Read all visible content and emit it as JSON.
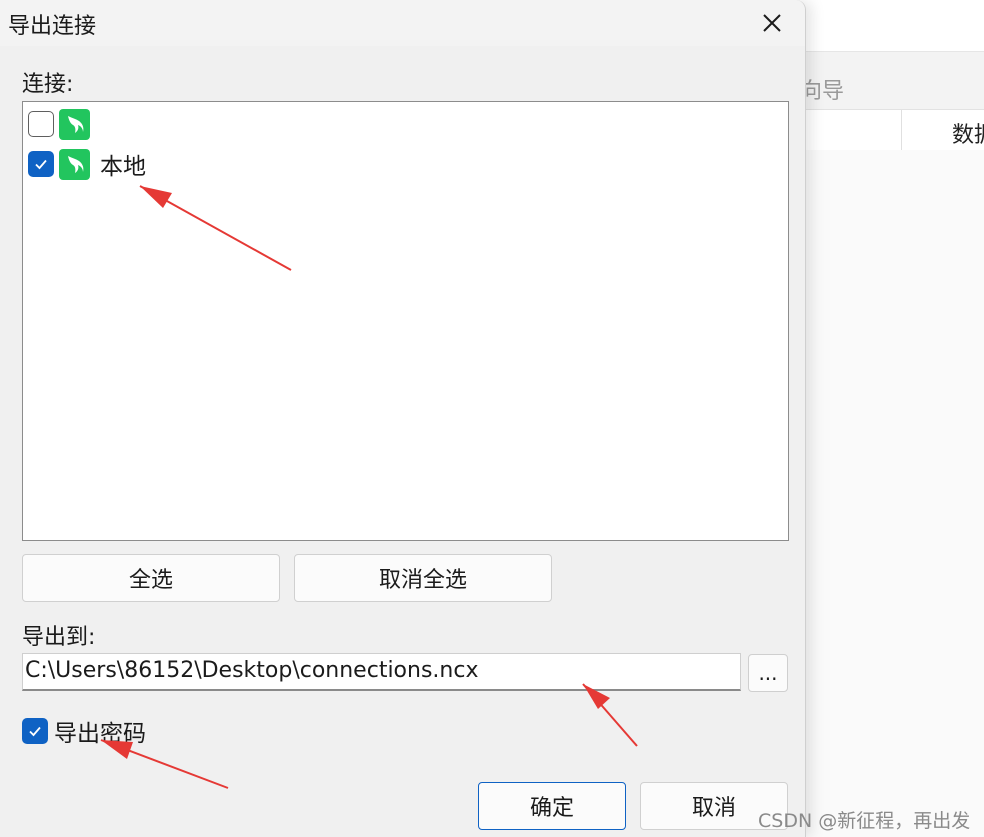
{
  "background_app": {
    "toolbar_label": "向导",
    "column_label": "数据"
  },
  "dialog": {
    "title": "导出连接",
    "connections_label": "连接:",
    "connections": [
      {
        "label": "",
        "checked": false,
        "icon": "mysql-dolphin-icon",
        "redacted": true
      },
      {
        "label": "本地",
        "checked": true,
        "icon": "mysql-dolphin-icon",
        "redacted": false
      }
    ],
    "select_all_label": "全选",
    "deselect_all_label": "取消全选",
    "export_to_label": "导出到:",
    "export_path": "C:\\Users\\86152\\Desktop\\connections.ncx",
    "browse_label": "...",
    "export_password_label": "导出密码",
    "export_password_checked": true,
    "ok_label": "确定",
    "cancel_label": "取消"
  },
  "watermark": "CSDN @新征程，再出发",
  "colors": {
    "accent": "#0f62c4",
    "db_icon": "#22c55e",
    "annotation_arrow": "#e53935",
    "dialog_bg": "#f0f0f0"
  }
}
